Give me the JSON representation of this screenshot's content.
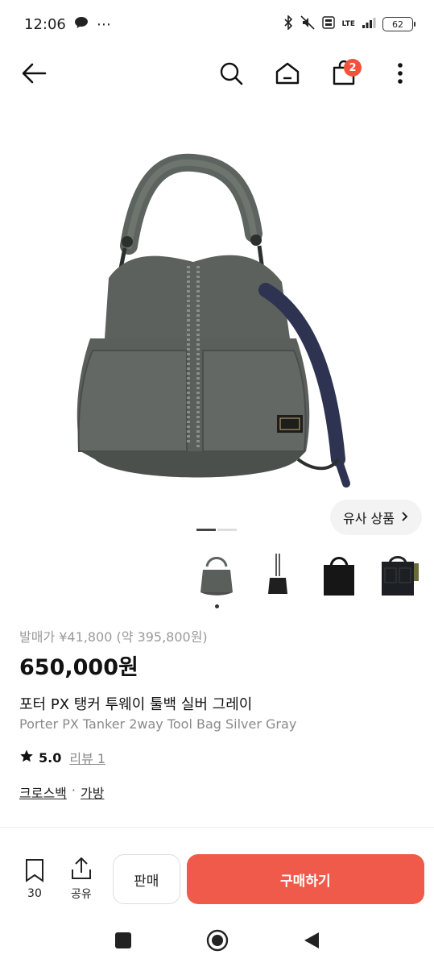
{
  "status_bar": {
    "time": "12:06",
    "battery": "62",
    "network": "LTE"
  },
  "nav": {
    "cart_count": "2"
  },
  "gallery": {
    "similar_label": "유사 상품",
    "page_count": 2,
    "current_page": 1,
    "thumbnails": [
      "bag-gray-front",
      "bag-black-hanging",
      "bag-black-tote",
      "bag-black-pocket"
    ]
  },
  "product": {
    "release_price": "발매가 ¥41,800 (약 395,800원)",
    "price": "650,000원",
    "title_ko": "포터 PX 탱커 투웨이 툴백 실버 그레이",
    "title_en": "Porter PX Tanker 2way Tool Bag Silver Gray",
    "rating": "5.0",
    "review_label": "리뷰 1",
    "category_1": "크로스백",
    "category_sep": "·",
    "category_2": "가방"
  },
  "actions": {
    "bookmark_count": "30",
    "share_label": "공유",
    "sell_label": "판매",
    "buy_label": "구매하기"
  },
  "colors": {
    "accent": "#ef5a4a",
    "badge": "#f2513a"
  }
}
